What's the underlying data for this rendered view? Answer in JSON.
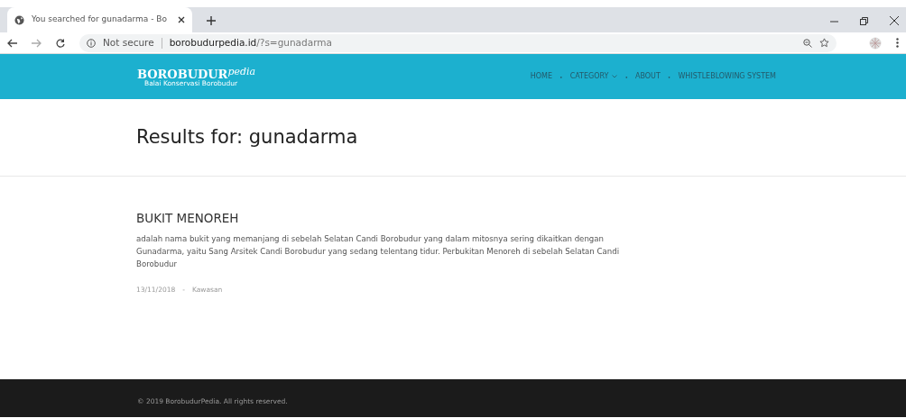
{
  "browser": {
    "tab_title": "You searched for gunadarma - Bo",
    "url_security": "Not secure",
    "url_host": "borobudurpedia.id",
    "url_path": "/?s=gunadarma"
  },
  "site": {
    "logo": {
      "main": "BOROBUDUR",
      "script": "pedia",
      "subtitle": "Balai Konservasi Borobudur"
    },
    "nav": [
      {
        "label": "HOME",
        "dropdown": false
      },
      {
        "label": "CATEGORY",
        "dropdown": true
      },
      {
        "label": "ABOUT",
        "dropdown": false
      },
      {
        "label": "WHISTLEBLOWING SYSTEM",
        "dropdown": false
      }
    ],
    "nav_separator": "•"
  },
  "page_title": "Results for: gunadarma",
  "results": [
    {
      "title": "BUKIT MENOREH",
      "excerpt": "adalah nama bukit yang memanjang di sebelah Selatan Candi Borobudur yang dalam mitosnya sering dikaitkan dengan Gunadarma, yaitu Sang Arsitek Candi Borobudur yang sedang telentang tidur. Perbukitan Menoreh di sebelah Selatan Candi Borobudur",
      "date": "13/11/2018",
      "separator": "-",
      "category": "Kawasan"
    }
  ],
  "footer": "© 2019 BorobudurPedia. All rights reserved."
}
